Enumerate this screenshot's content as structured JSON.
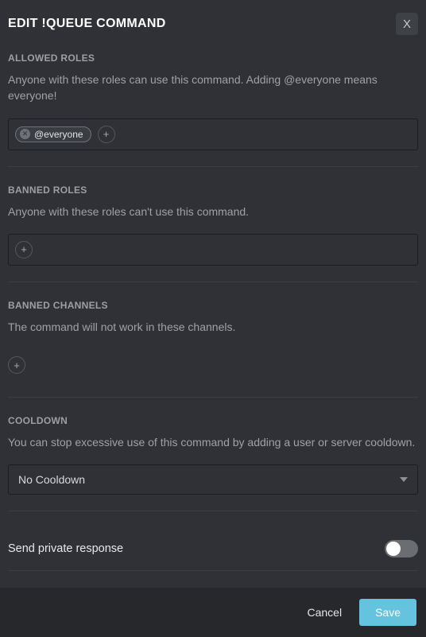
{
  "title": "EDIT !QUEUE COMMAND",
  "close_label": "X",
  "sections": {
    "allowed_roles": {
      "label": "ALLOWED ROLES",
      "desc": "Anyone with these roles can use this command. Adding @everyone means everyone!",
      "chips": [
        {
          "label": "@everyone"
        }
      ]
    },
    "banned_roles": {
      "label": "BANNED ROLES",
      "desc": "Anyone with these roles can't use this command."
    },
    "banned_channels": {
      "label": "BANNED CHANNELS",
      "desc": "The command will not work in these channels."
    },
    "cooldown": {
      "label": "COOLDOWN",
      "desc": "You can stop excessive use of this command by adding a user or server cooldown.",
      "selected": "No Cooldown"
    },
    "private_response": {
      "label": "Send private response",
      "enabled": false
    }
  },
  "footer": {
    "cancel": "Cancel",
    "save": "Save"
  }
}
